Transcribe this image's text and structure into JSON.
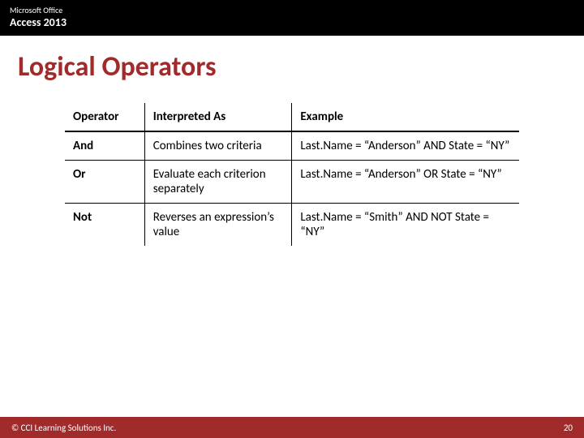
{
  "header": {
    "brand": "Microsoft Office",
    "product": "Access 2013"
  },
  "title": "Logical Operators",
  "table": {
    "columns": {
      "c0": "Operator",
      "c1": "Interpreted As",
      "c2": "Example"
    },
    "rows": [
      {
        "op": "And",
        "interp": "Combines two criteria",
        "ex": "Last.Name = “Anderson” AND State = “NY”"
      },
      {
        "op": "Or",
        "interp": "Evaluate each criterion separately",
        "ex": "Last.Name = “Anderson” OR State = “NY”"
      },
      {
        "op": "Not",
        "interp": "Reverses an expression’s value",
        "ex": "Last.Name = “Smith” AND NOT State = “NY”"
      }
    ]
  },
  "footer": {
    "copyright": "© CCI Learning Solutions Inc.",
    "page": "20"
  }
}
